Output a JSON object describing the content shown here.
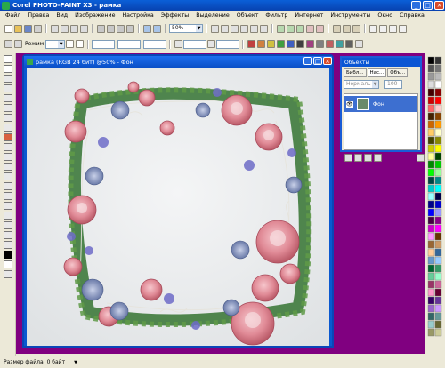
{
  "window": {
    "title": "Corel PHOTO-PAINT X3 - рамка"
  },
  "menu": [
    "Файл",
    "Правка",
    "Вид",
    "Изображение",
    "Настройка",
    "Эффекты",
    "Выделение",
    "Объект",
    "Фильтр",
    "Интернет",
    "Инструменты",
    "Окно",
    "Справка"
  ],
  "toolbar": {
    "zoom": "50%"
  },
  "property_bar": {
    "mode_label": "Режим"
  },
  "document": {
    "title": "рамка (RGB 24 бит) @50% - Фон"
  },
  "objects_panel": {
    "title": "Объекты",
    "tabs": [
      "Библ...",
      "Нас...",
      "Объ..."
    ],
    "mode": "Нормаль",
    "opacity": "100",
    "layer_name": "Фон"
  },
  "status": {
    "file_size": "Размер файла: 0 байт"
  },
  "colors": {
    "accent": "#0a58d0",
    "workspace": "#800080",
    "chrome": "#ece9d8"
  }
}
